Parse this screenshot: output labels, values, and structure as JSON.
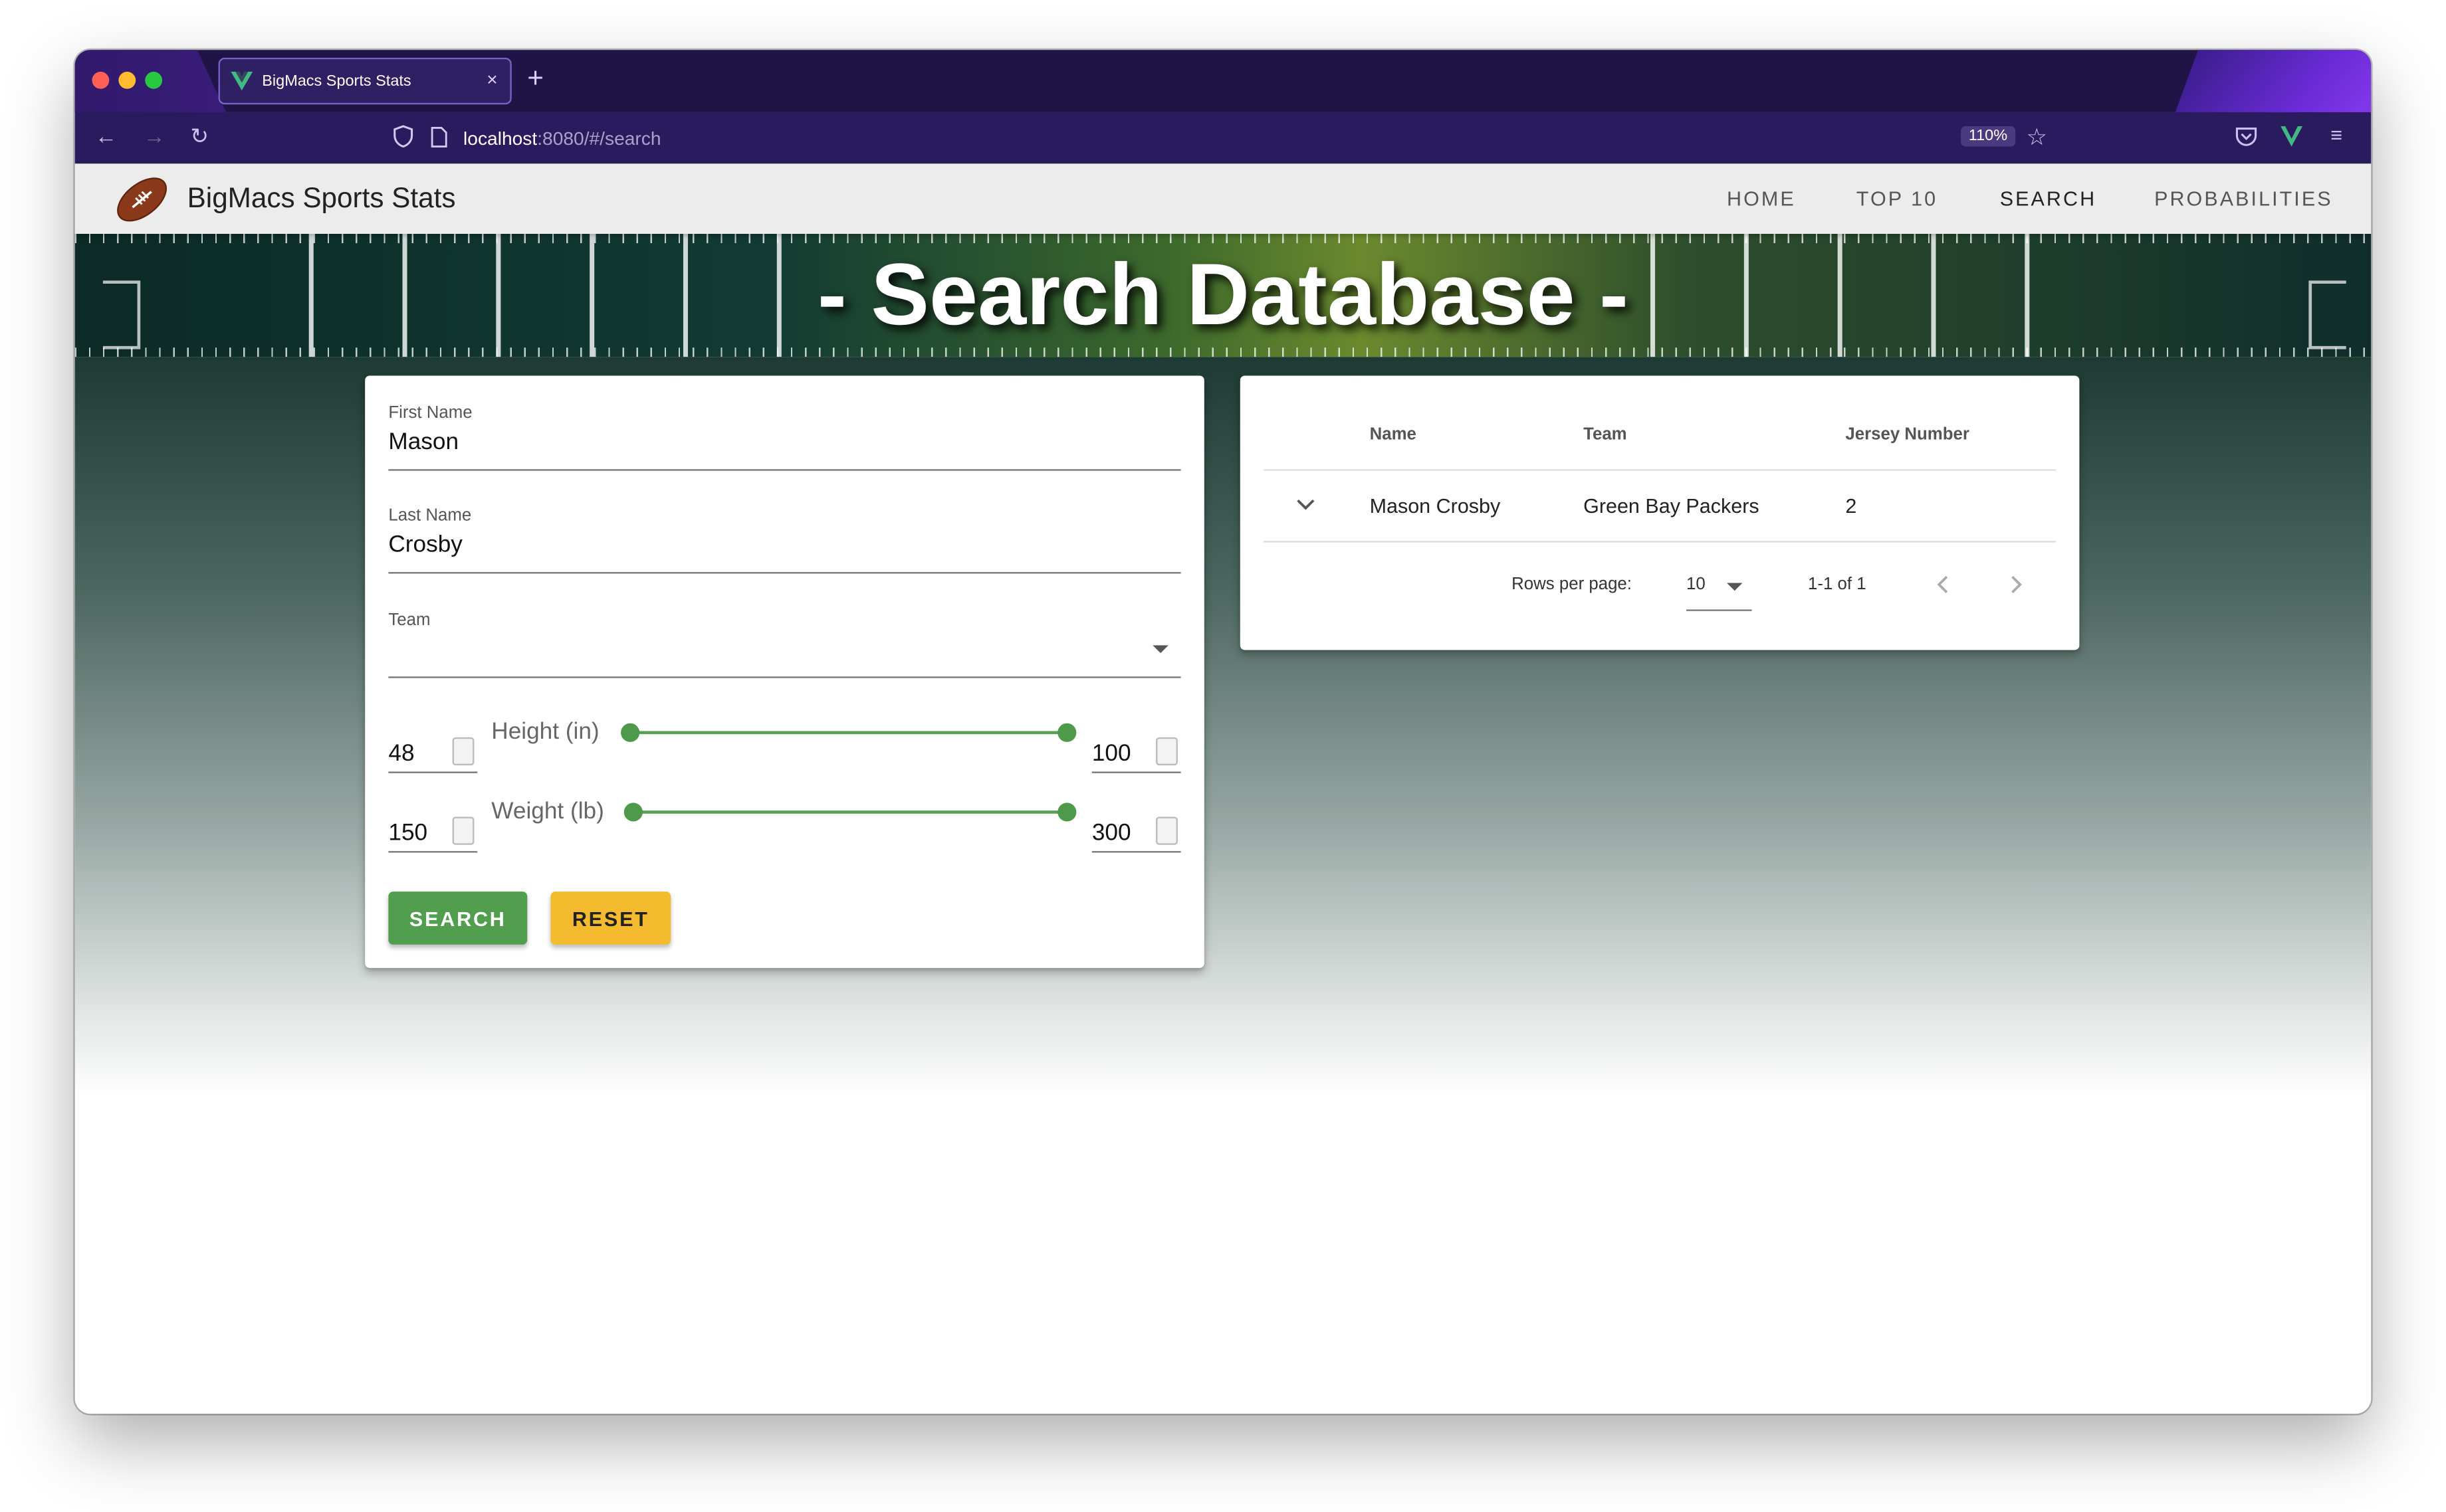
{
  "browser": {
    "tab_title": "BigMacs Sports Stats",
    "tab_close": "×",
    "new_tab": "+",
    "url_host": "localhost",
    "url_rest": ":8080/#/search",
    "zoom": "110%",
    "colors": {
      "tabstrip": "#201446",
      "navbar": "#2a1b5e"
    }
  },
  "app": {
    "brand": "BigMacs Sports Stats",
    "nav": [
      {
        "label": "HOME"
      },
      {
        "label": "TOP 10"
      },
      {
        "label": "SEARCH",
        "active": true
      },
      {
        "label": "PROBABILITIES"
      }
    ],
    "hero_title": "- Search Database -"
  },
  "form": {
    "first_name": {
      "label": "First Name",
      "value": "Mason"
    },
    "last_name": {
      "label": "Last Name",
      "value": "Crosby"
    },
    "team": {
      "label": "Team",
      "value": ""
    },
    "height": {
      "label": "Height (in)",
      "min": "48",
      "max": "100",
      "range": [
        0.0,
        1.0
      ]
    },
    "weight": {
      "label": "Weight (lb)",
      "min": "150",
      "max": "300",
      "range": [
        0.0,
        1.0
      ]
    },
    "search_button": "SEARCH",
    "reset_button": "RESET",
    "colors": {
      "accent": "#4e9a4a",
      "search_bg": "#519e4f",
      "reset_bg": "#f5bb2f"
    }
  },
  "results": {
    "columns": [
      "Name",
      "Team",
      "Jersey Number"
    ],
    "rows": [
      {
        "name": "Mason Crosby",
        "team": "Green Bay Packers",
        "jersey": "2"
      }
    ],
    "rows_per_page_label": "Rows per page:",
    "rows_per_page": "10",
    "page_info": "1-1 of 1"
  }
}
